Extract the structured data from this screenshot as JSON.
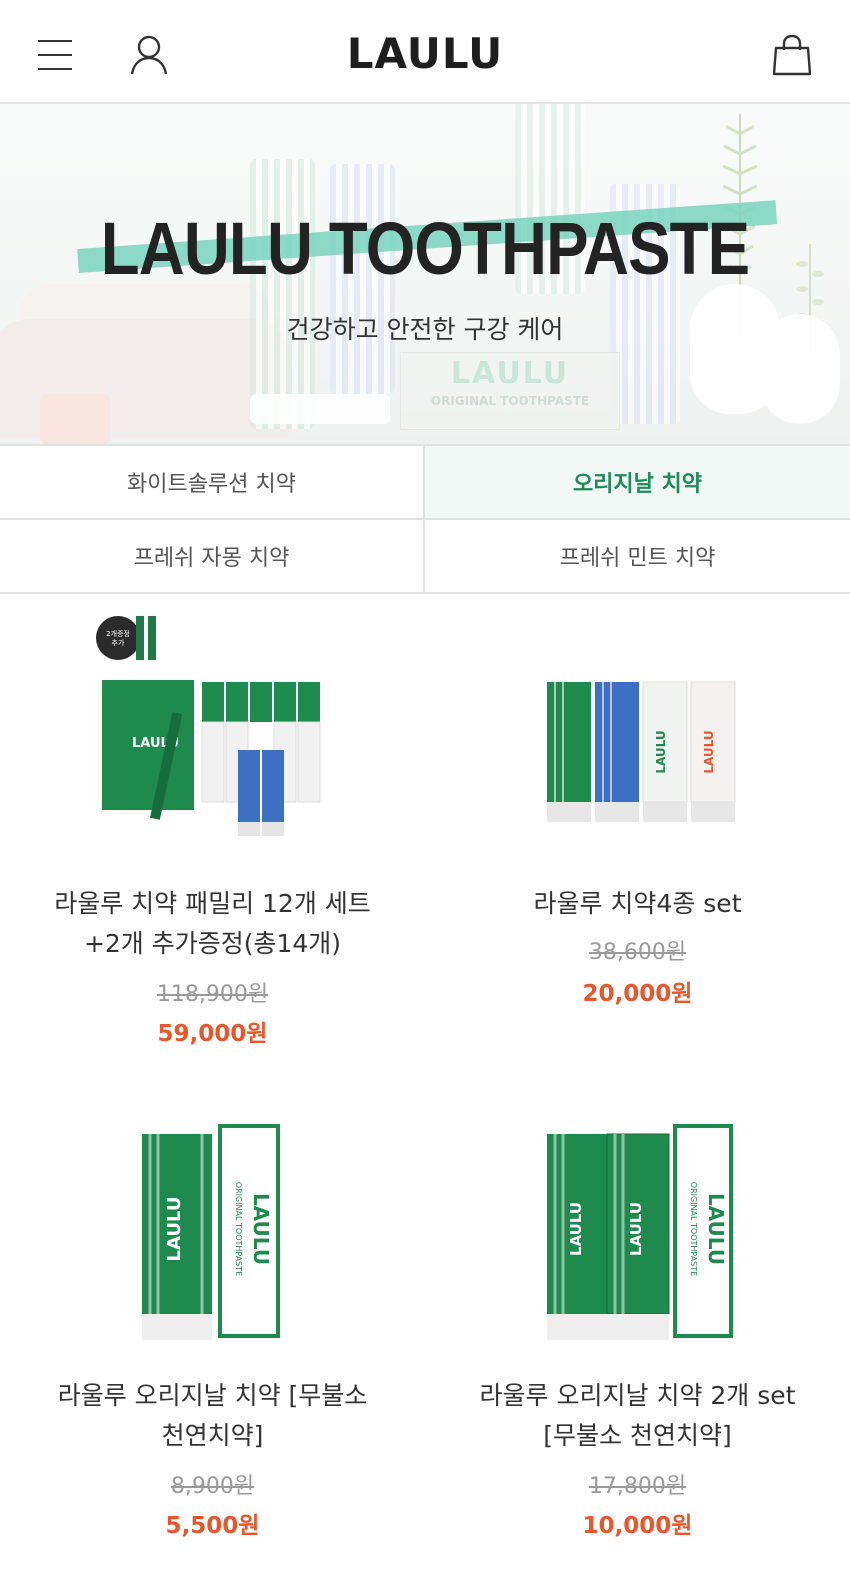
{
  "header": {
    "logo": "LAULU",
    "icons": [
      "hamburger-menu-icon",
      "user-icon",
      "shopping-bag-icon"
    ]
  },
  "banner": {
    "title": "LAULU TOOTHPASTE",
    "subtitle": "건강하고 안전한 구강 케어",
    "box_brand": "LAULU",
    "box_sub": "ORIGINAL TOOTHPASTE"
  },
  "categories": [
    {
      "label": "화이트솔루션 치약",
      "active": false
    },
    {
      "label": "오리지날 치약",
      "active": true
    },
    {
      "label": "프레쉬 자몽 치약",
      "active": false
    },
    {
      "label": "프레쉬 민트 치약",
      "active": false
    }
  ],
  "products": [
    {
      "name_line1": "라울루 치약 패밀리 12개 세트",
      "name_line2": "+2개 추가증정(총14개)",
      "original_price": "118,900원",
      "sale_price": "59,000원",
      "badge": "2개추가 추가증정",
      "box_brand": "LAULU"
    },
    {
      "name_line1": "라울루 치약4종 set",
      "name_line2": "",
      "original_price": "38,600원",
      "sale_price": "20,000원"
    },
    {
      "name_line1": "라울루 오리지날 치약 [무불소",
      "name_line2": "천연치약]",
      "original_price": "8,900원",
      "sale_price": "5,500원",
      "box_brand": "LAULU",
      "box_sub": "ORIGINAL TOOTHPASTE"
    },
    {
      "name_line1": "라울루 오리지날 치약 2개 set",
      "name_line2": "[무불소 천연치약]",
      "original_price": "17,800원",
      "sale_price": "10,000원",
      "box_brand": "LAULU",
      "box_sub": "ORIGINAL TOOTHPASTE"
    }
  ],
  "colors": {
    "accent_green": "#1e8a57",
    "sale_orange": "#e8562a",
    "strike_gray": "#9a9a9a",
    "banner_stripe": "#79d4bd"
  }
}
